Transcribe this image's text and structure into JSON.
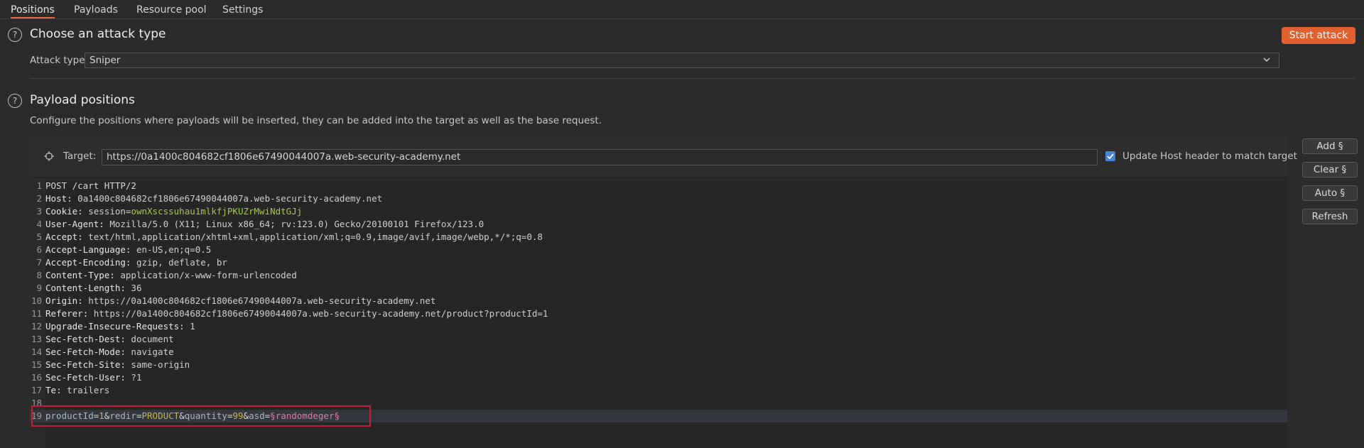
{
  "tabs": [
    "Positions",
    "Payloads",
    "Resource pool",
    "Settings"
  ],
  "attack_type_section": {
    "help_icon": "question-circle-icon",
    "title": "Choose an attack type",
    "start_button": "Start attack",
    "label": "Attack type:",
    "selected": "Sniper"
  },
  "payload_section": {
    "help_icon": "question-circle-icon",
    "title": "Payload positions",
    "description": "Configure the positions where payloads will be inserted, they can be added into the target as well as the base request.",
    "target_label": "Target:",
    "target_url": "https://0a1400c804682cf1806e67490044007a.web-security-academy.net",
    "update_host_checked": true,
    "update_host_label": "Update Host header to match target",
    "buttons": [
      "Add §",
      "Clear §",
      "Auto §",
      "Refresh"
    ]
  },
  "request": {
    "request_line": "POST /cart HTTP/2",
    "headers": [
      {
        "key": "Host",
        "value": "0a1400c804682cf1806e67490044007a.web-security-academy.net"
      },
      {
        "key": "Cookie",
        "value_prefix": "session=",
        "value_cookie": "ownXscssuhau1mlkfjPKUZrMwiNdtGJj"
      },
      {
        "key": "User-Agent",
        "value": "Mozilla/5.0 (X11; Linux x86_64; rv:123.0) Gecko/20100101 Firefox/123.0"
      },
      {
        "key": "Accept",
        "value": "text/html,application/xhtml+xml,application/xml;q=0.9,image/avif,image/webp,*/*;q=0.8"
      },
      {
        "key": "Accept-Language",
        "value": "en-US,en;q=0.5"
      },
      {
        "key": "Accept-Encoding",
        "value": "gzip, deflate, br"
      },
      {
        "key": "Content-Type",
        "value": "application/x-www-form-urlencoded"
      },
      {
        "key": "Content-Length",
        "value": "36"
      },
      {
        "key": "Origin",
        "value": "https://0a1400c804682cf1806e67490044007a.web-security-academy.net"
      },
      {
        "key": "Referer",
        "value": "https://0a1400c804682cf1806e67490044007a.web-security-academy.net/product?productId=1"
      },
      {
        "key": "Upgrade-Insecure-Requests",
        "value": "1"
      },
      {
        "key": "Sec-Fetch-Dest",
        "value": "document"
      },
      {
        "key": "Sec-Fetch-Mode",
        "value": "navigate"
      },
      {
        "key": "Sec-Fetch-Site",
        "value": "same-origin"
      },
      {
        "key": "Sec-Fetch-User",
        "value": "?1"
      },
      {
        "key": "Te",
        "value": "trailers"
      }
    ],
    "body": {
      "k1": "productId",
      "v1": "1",
      "k2": "redir",
      "v2": "PRODUCT",
      "k3": "quantity",
      "v3": "99",
      "k4": "asd",
      "v4": "§randomdeger§"
    }
  },
  "colors": {
    "accent": "#e0612f",
    "highlight_border": "#c0213a",
    "cookie_value": "#a6c84c",
    "payload_marker": "#e07aa6"
  }
}
